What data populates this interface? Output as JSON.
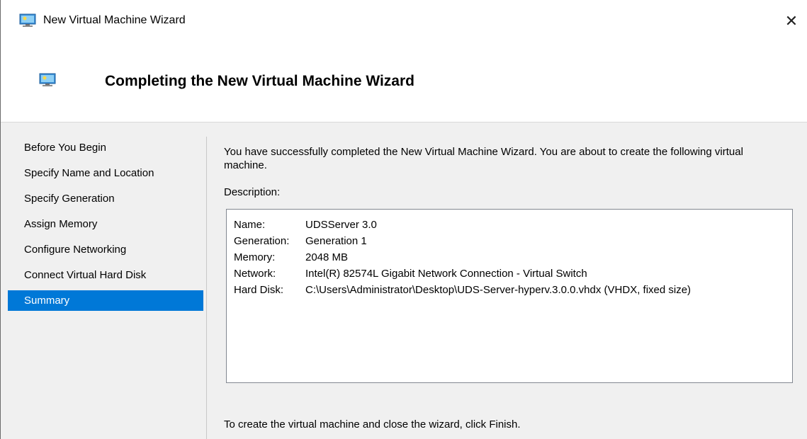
{
  "window": {
    "title": "New Virtual Machine Wizard",
    "icon": "virtual-machine-icon",
    "close_glyph": "✕"
  },
  "header": {
    "title": "Completing the New Virtual Machine Wizard",
    "icon": "virtual-machine-icon"
  },
  "nav": {
    "items": [
      {
        "label": "Before You Begin",
        "selected": false
      },
      {
        "label": "Specify Name and Location",
        "selected": false
      },
      {
        "label": "Specify Generation",
        "selected": false
      },
      {
        "label": "Assign Memory",
        "selected": false
      },
      {
        "label": "Configure Networking",
        "selected": false
      },
      {
        "label": "Connect Virtual Hard Disk",
        "selected": false
      },
      {
        "label": "Summary",
        "selected": true
      }
    ]
  },
  "content": {
    "intro": "You have successfully completed the New Virtual Machine Wizard. You are about to create the following virtual machine.",
    "description_label": "Description:",
    "description": [
      {
        "key": "Name:",
        "value": "UDSServer 3.0"
      },
      {
        "key": "Generation:",
        "value": "Generation 1"
      },
      {
        "key": "Memory:",
        "value": "2048 MB"
      },
      {
        "key": "Network:",
        "value": "Intel(R) 82574L Gigabit Network Connection - Virtual Switch"
      },
      {
        "key": "Hard Disk:",
        "value": "C:\\Users\\Administrator\\Desktop\\UDS-Server-hyperv.3.0.0.vhdx (VHDX, fixed size)"
      }
    ],
    "footer": "To create the virtual machine and close the wizard, click Finish."
  },
  "colors": {
    "selection": "#0078d7",
    "panel_background": "#f0f0f0",
    "header_background": "#ffffff"
  }
}
